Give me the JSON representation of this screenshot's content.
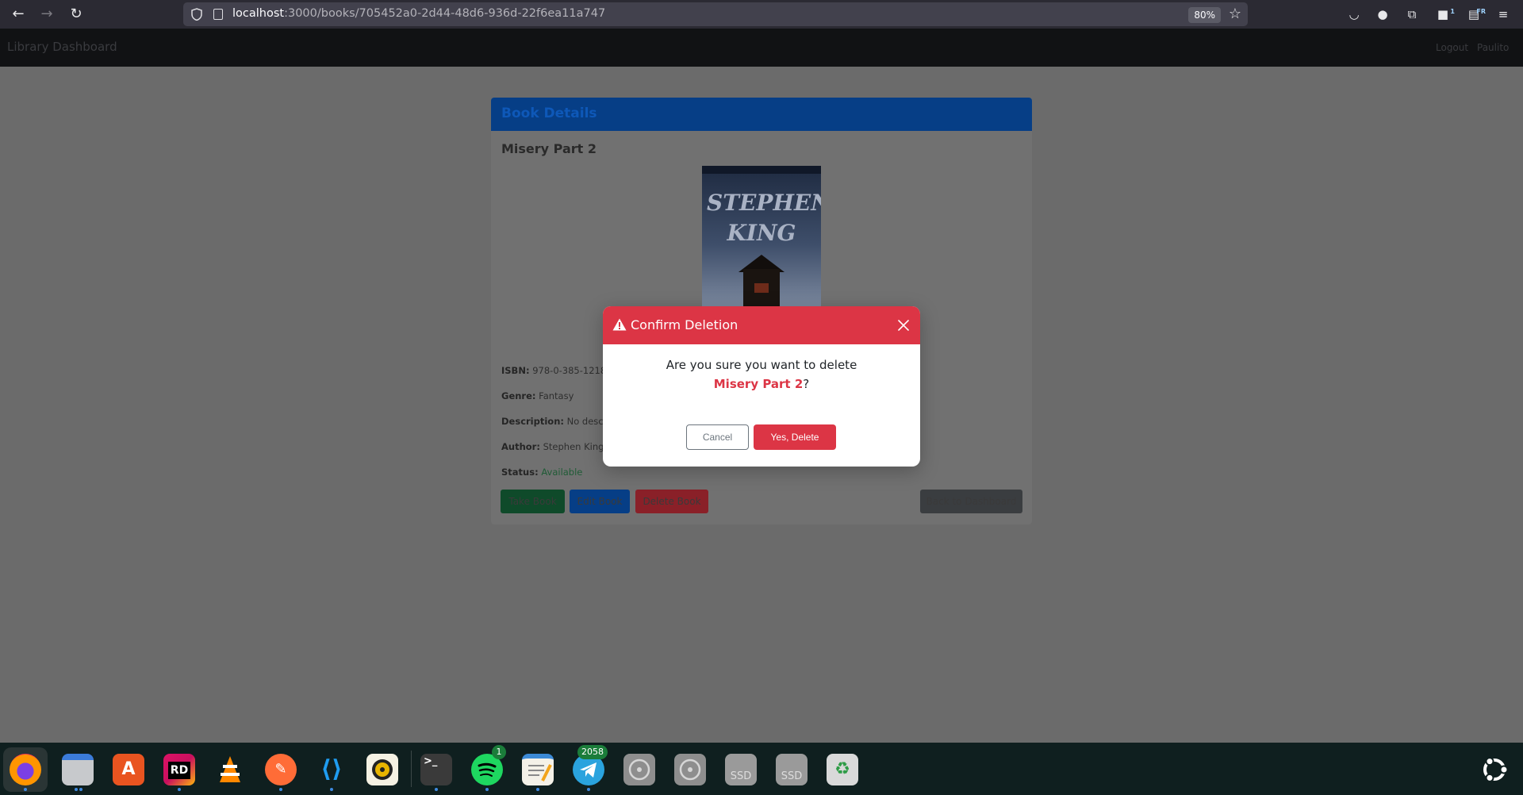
{
  "browser": {
    "url_host": "localhost",
    "url_path": ":3000/books/705452a0-2d44-48d6-936d-22f6ea11a747",
    "zoom": "80%",
    "toolbar_badge_count": "1",
    "language_badge": "FR"
  },
  "app": {
    "brand": "Library Dashboard",
    "nav_links": [
      "Logout",
      "Paulito"
    ]
  },
  "card": {
    "header_title": "Book Details",
    "book_title": "Misery Part 2",
    "cover_author": "STEPHEN KING",
    "details": [
      {
        "label": "ISBN:",
        "value": "978-0-385-1218"
      },
      {
        "label": "Genre:",
        "value": "Fantasy"
      },
      {
        "label": "Description:",
        "value": "No descr"
      },
      {
        "label": "Author:",
        "value": "Stephen King"
      },
      {
        "label": "Status:",
        "value": "Available"
      }
    ],
    "buttons": {
      "take": "Take Book",
      "edit": "Edit Book",
      "delete": "Delete Book",
      "back": "Back to Dashboard"
    }
  },
  "modal": {
    "title": "Confirm Deletion",
    "message": "Are you sure you want to delete",
    "target": "Misery Part 2",
    "suffix": "?",
    "cancel_label": "Cancel",
    "confirm_label": "Yes, Delete",
    "colors": {
      "danger": "#dc3545",
      "secondary": "#6c757d"
    }
  },
  "dock": {
    "items": [
      {
        "name": "firefox-icon",
        "label": ""
      },
      {
        "name": "files-icon",
        "label": ""
      },
      {
        "name": "app-center-icon",
        "label": ""
      },
      {
        "name": "rider-icon",
        "label": "RD"
      },
      {
        "name": "vlc-icon",
        "label": ""
      },
      {
        "name": "postman-icon",
        "label": ""
      },
      {
        "name": "vscode-icon",
        "label": ""
      },
      {
        "name": "rhythmbox-icon",
        "label": ""
      },
      {
        "name": "terminal-icon",
        "label": ">_"
      },
      {
        "name": "spotify-icon",
        "label": "",
        "badge": "1"
      },
      {
        "name": "text-editor-icon",
        "label": ""
      },
      {
        "name": "telegram-icon",
        "label": "",
        "badge": "2058"
      },
      {
        "name": "disc-icon",
        "label": ""
      },
      {
        "name": "disc-icon-2",
        "label": ""
      },
      {
        "name": "ssd-drive-icon",
        "label": "SSD"
      },
      {
        "name": "ssd-drive-icon-2",
        "label": "SSD"
      },
      {
        "name": "trash-icon",
        "label": "♻"
      },
      {
        "name": "ubuntu-apps-icon",
        "label": ""
      }
    ]
  }
}
